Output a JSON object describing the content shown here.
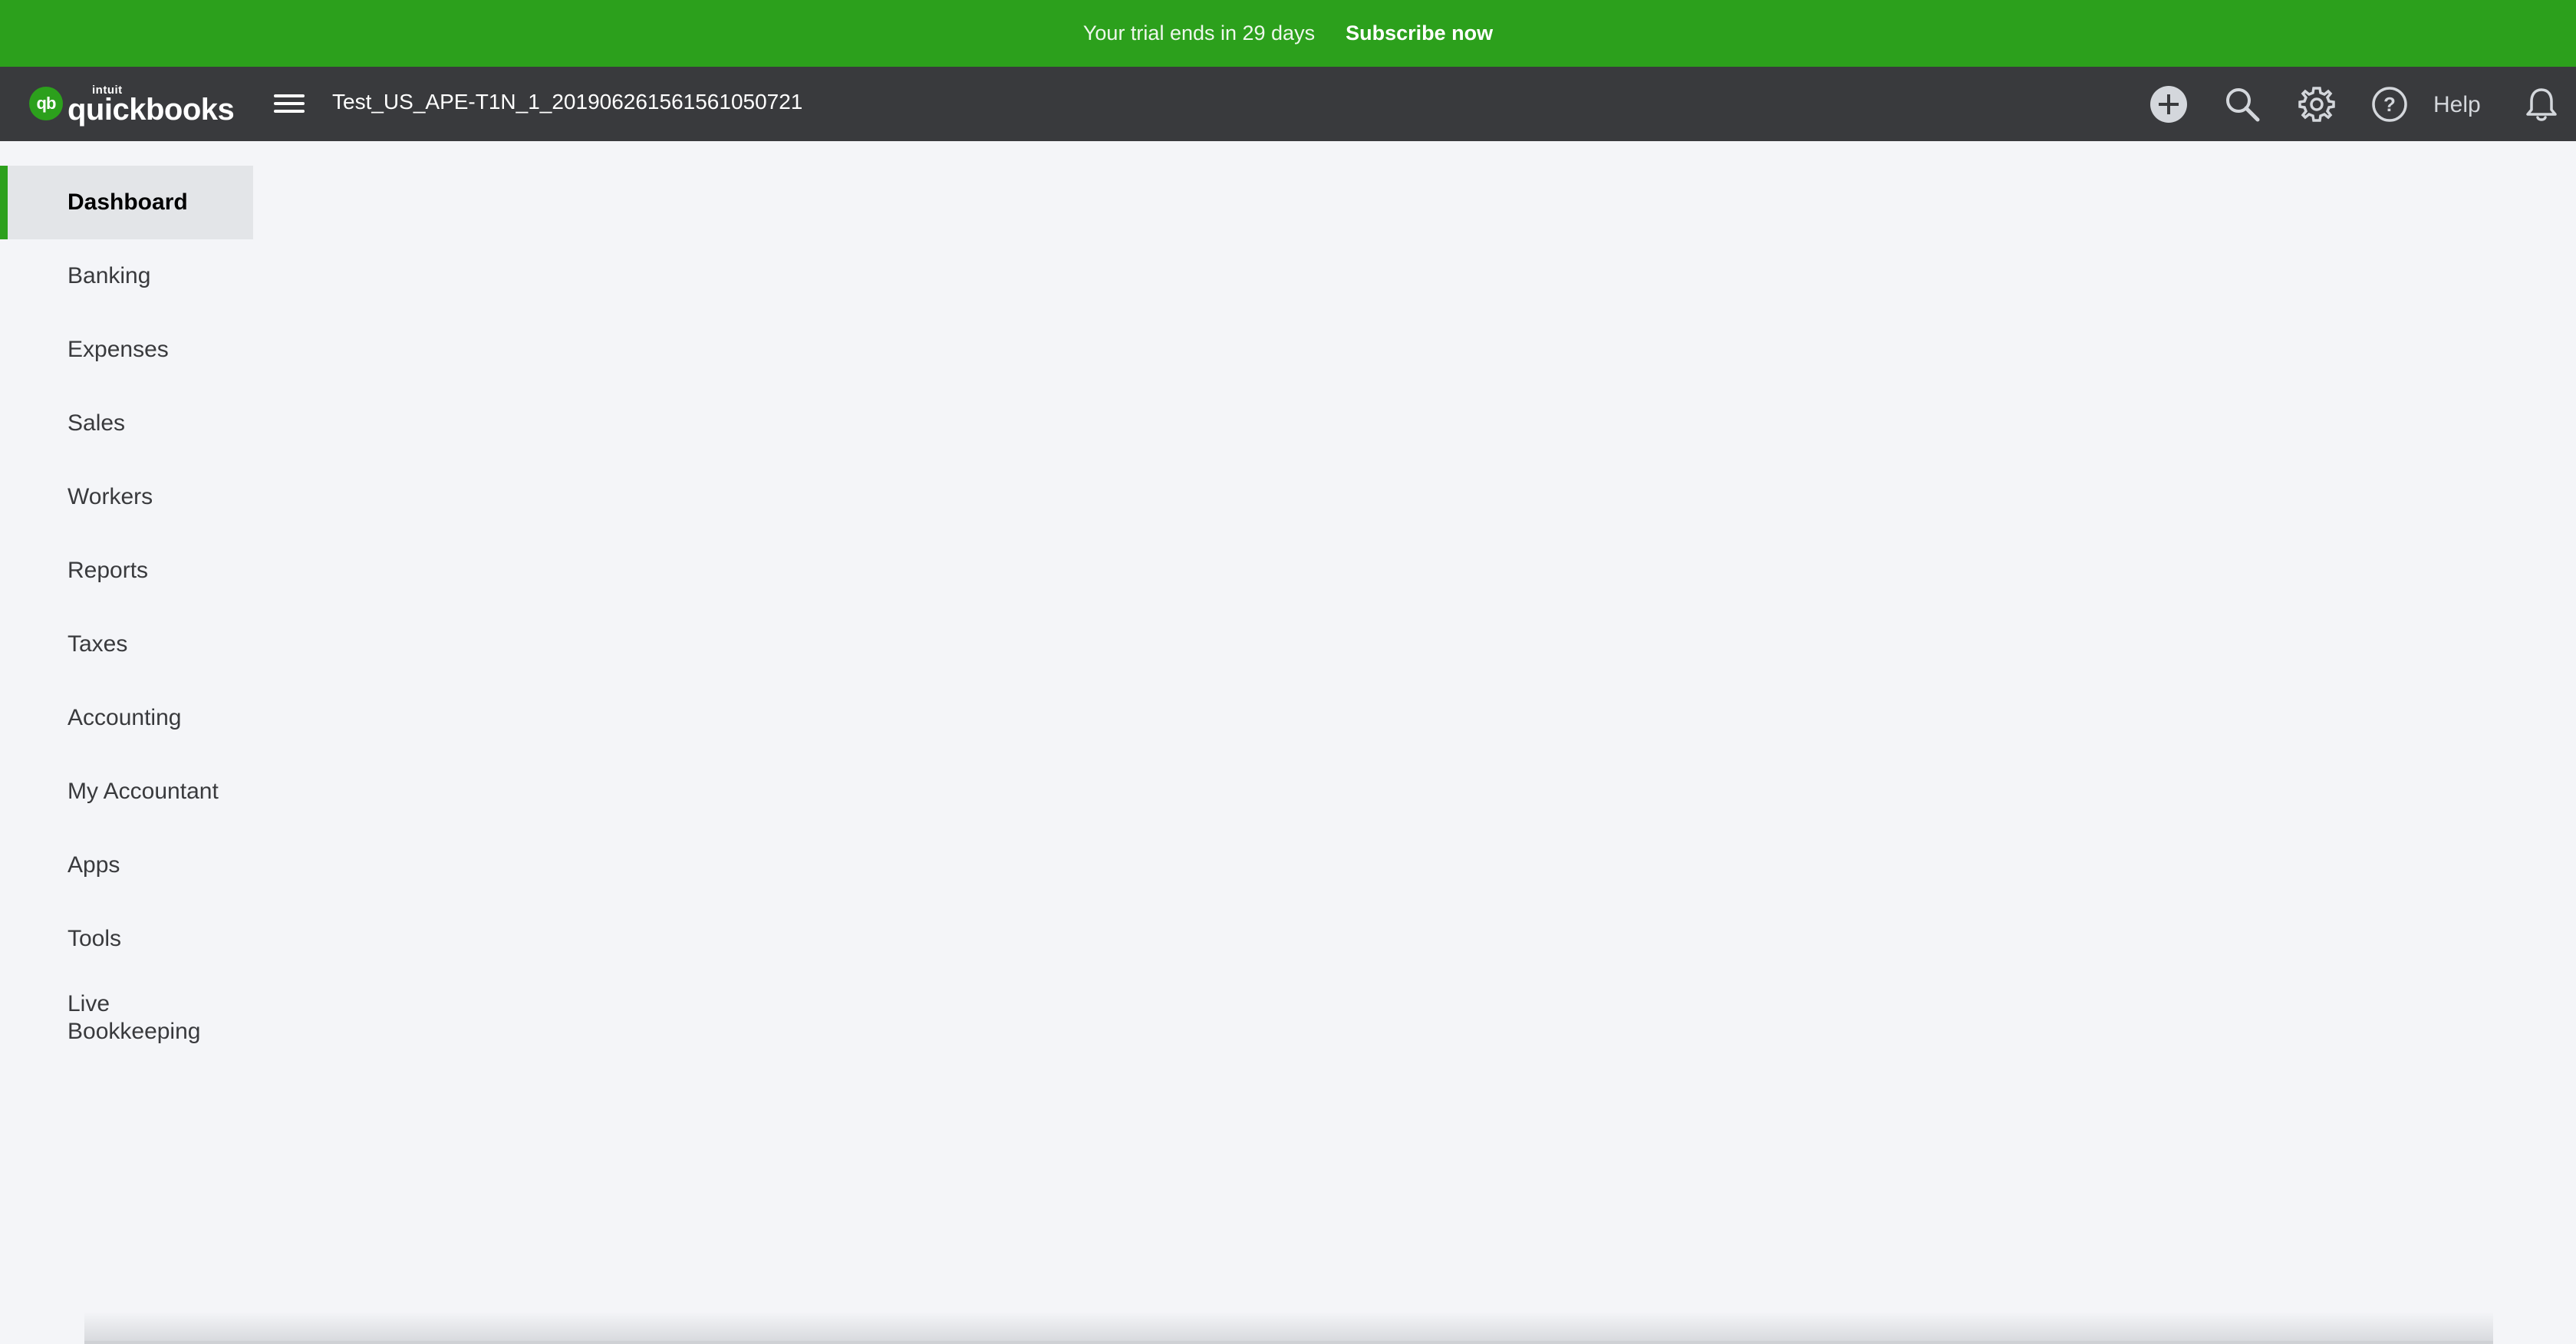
{
  "banner": {
    "trial_text": "Your trial ends in 29 days",
    "subscribe_label": "Subscribe now",
    "color": "#2ca01c"
  },
  "header": {
    "logo_small": "intuit",
    "logo_word": "quickbooks",
    "logo_mark": "qb",
    "company_name": "Test_US_APE-T1N_1_20190626156156105072​1",
    "help_label": "Help",
    "icons": [
      "plus-circle-icon",
      "search-icon",
      "gear-icon",
      "question-circle-icon",
      "bell-icon"
    ],
    "background": "#393a3d"
  },
  "sidebar": {
    "items": [
      {
        "label": "Dashboard",
        "active": true
      },
      {
        "label": "Banking"
      },
      {
        "label": "Expenses"
      },
      {
        "label": "Sales"
      },
      {
        "label": "Workers"
      },
      {
        "label": "Reports"
      },
      {
        "label": "Taxes"
      },
      {
        "label": "Accounting"
      },
      {
        "label": "My Accountant"
      },
      {
        "label": "Apps"
      },
      {
        "label": "Tools"
      },
      {
        "label": "Live\nBookkeeping"
      }
    ],
    "accent": "#2ca01c"
  }
}
